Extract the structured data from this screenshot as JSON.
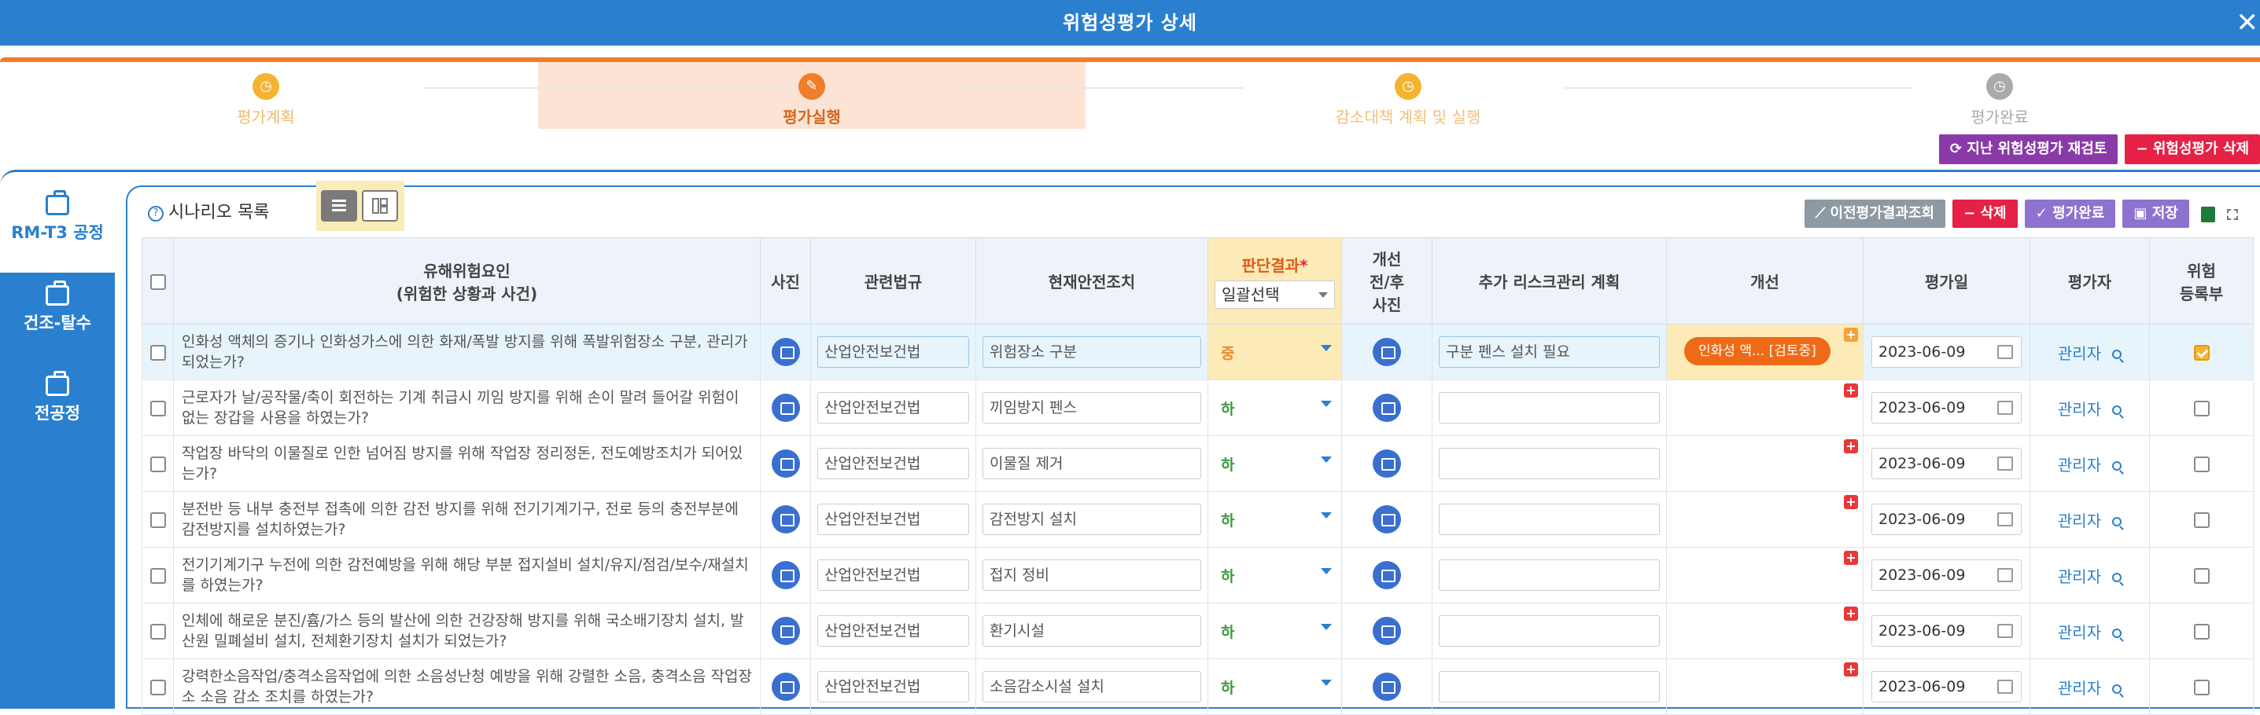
{
  "window": {
    "title": "위험성평가 상세",
    "close_label": "✕"
  },
  "steps": [
    {
      "label": "평가계획",
      "color": "#f4b330",
      "text_color": "#f3b868",
      "icon": "clock-icon",
      "glyph": "◷"
    },
    {
      "label": "평가실행",
      "color": "#ef7d2a",
      "text_color": "#d4661e",
      "icon": "pencil-icon",
      "glyph": "✎"
    },
    {
      "label": "감소대책 계획 및 실행",
      "color": "#f4b330",
      "text_color": "#f3c07a",
      "icon": "clock-icon",
      "glyph": "◷"
    },
    {
      "label": "평가완료",
      "color": "#aaaaaa",
      "text_color": "#aaaaaa",
      "icon": "clock-icon",
      "glyph": "◷"
    }
  ],
  "top_buttons": {
    "review": "지난 위험성평가 재검토",
    "delete": "위험성평가 삭제"
  },
  "side_tabs": [
    {
      "label": "RM-T3 공정",
      "active": true
    },
    {
      "label": "건조-탈수",
      "active": false
    },
    {
      "label": "전공정",
      "active": false
    }
  ],
  "toolbar": {
    "title": "시나리오 목록",
    "prev_result": "이전평가결과조회",
    "delete": "삭제",
    "complete": "평가완료",
    "save": "저장"
  },
  "columns": {
    "hazard_line1": "유해위험요인",
    "hazard_line2": "(위험한 상황과 사건)",
    "photo": "사진",
    "law": "관련법규",
    "current": "현재안전조치",
    "judge": "판단결과",
    "judge_required": "*",
    "judge_select": "일괄선택",
    "before_after_l1": "개선",
    "before_after_l2": "전/후",
    "before_after_l3": "사진",
    "plan": "추가 리스크관리 계획",
    "improve": "개선",
    "date": "평가일",
    "evaluator": "평가자",
    "register_l1": "위험",
    "register_l2": "등록부"
  },
  "rows": [
    {
      "hazard": "인화성 액체의 증기나 인화성가스에 의한 화재/폭발 방지를 위해 폭발위험장소 구분, 관리가 되었는가?",
      "law": "산업안전보건법",
      "current": "위험장소 구분",
      "judge": "중",
      "judge_color": "#ef8a2a",
      "plan": "구분 펜스 설치 필요",
      "improve": "인화성 액... [검토중]",
      "date": "2023-06-09",
      "evaluator": "관리자",
      "registered": true,
      "selected": true
    },
    {
      "hazard": "근로자가 날/공작물/축이 회전하는 기계 취급시 끼임 방지를 위해 손이 말려 들어갈 위험이 없는 장갑을 사용을 하였는가?",
      "law": "산업안전보건법",
      "current": "끼임방지 펜스",
      "judge": "하",
      "judge_color": "#3a9a3a",
      "plan": "",
      "improve": "",
      "date": "2023-06-09",
      "evaluator": "관리자",
      "registered": false,
      "selected": false
    },
    {
      "hazard": "작업장 바닥의 이물질로 인한 넘어짐 방지를 위해 작업장 정리정돈, 전도예방조치가 되어있는가?",
      "law": "산업안전보건법",
      "current": "이물질 제거",
      "judge": "하",
      "judge_color": "#3a9a3a",
      "plan": "",
      "improve": "",
      "date": "2023-06-09",
      "evaluator": "관리자",
      "registered": false,
      "selected": false
    },
    {
      "hazard": "분전반 등 내부 충전부 접촉에 의한 감전 방지를 위해 전기기계기구, 전로 등의 충전부분에 감전방지를 설치하였는가?",
      "law": "산업안전보건법",
      "current": "감전방지 설치",
      "judge": "하",
      "judge_color": "#3a9a3a",
      "plan": "",
      "improve": "",
      "date": "2023-06-09",
      "evaluator": "관리자",
      "registered": false,
      "selected": false
    },
    {
      "hazard": "전기기계기구 누전에 의한 감전예방을 위해 해당 부분 접지설비 설치/유지/점검/보수/재설치를 하였는가?",
      "law": "산업안전보건법",
      "current": "접지 정비",
      "judge": "하",
      "judge_color": "#3a9a3a",
      "plan": "",
      "improve": "",
      "date": "2023-06-09",
      "evaluator": "관리자",
      "registered": false,
      "selected": false
    },
    {
      "hazard": "인체에 해로운 분진/흄/가스 등의 발산에 의한 건강장해 방지를 위해 국소배기장치 설치, 발산원 밀폐설비 설치, 전체환기장치 설치가 되었는가?",
      "law": "산업안전보건법",
      "current": "환기시설",
      "judge": "하",
      "judge_color": "#3a9a3a",
      "plan": "",
      "improve": "",
      "date": "2023-06-09",
      "evaluator": "관리자",
      "registered": false,
      "selected": false
    },
    {
      "hazard": "강력한소음작업/충격소음작업에 의한 소음성난청 예방을 위해 강렬한 소음, 충격소음 작업장소 소음 감소 조치를 하였는가?",
      "law": "산업안전보건법",
      "current": "소음감소시설 설치",
      "judge": "하",
      "judge_color": "#3a9a3a",
      "plan": "",
      "improve": "",
      "date": "2023-06-09",
      "evaluator": "관리자",
      "registered": false,
      "selected": false
    }
  ]
}
